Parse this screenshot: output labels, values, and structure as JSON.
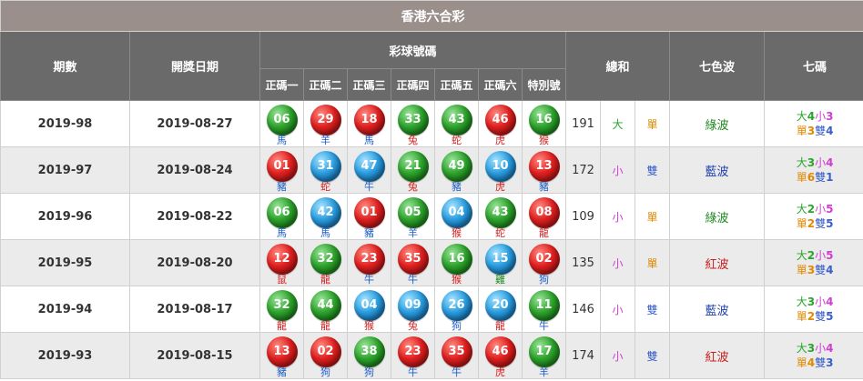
{
  "title": "香港六合彩",
  "headers": {
    "period": "期數",
    "date": "開獎日期",
    "balls": "彩球號碼",
    "sum": "總和",
    "seven_wave": "七色波",
    "seven_code": "七碼",
    "sub": [
      "正碼一",
      "正碼二",
      "正碼三",
      "正碼四",
      "正碼五",
      "正碼六",
      "特別號"
    ]
  },
  "rows": [
    {
      "period": "2019-98",
      "date": "2019-08-27",
      "balls": [
        {
          "num": "06",
          "color": "green",
          "zodiac": "馬",
          "zc": "blue"
        },
        {
          "num": "29",
          "color": "red",
          "zodiac": "羊",
          "zc": "blue"
        },
        {
          "num": "18",
          "color": "red",
          "zodiac": "馬",
          "zc": "blue"
        },
        {
          "num": "33",
          "color": "green",
          "zodiac": "兔",
          "zc": "red"
        },
        {
          "num": "43",
          "color": "green",
          "zodiac": "蛇",
          "zc": "red"
        },
        {
          "num": "46",
          "color": "red",
          "zodiac": "虎",
          "zc": "red"
        },
        {
          "num": "16",
          "color": "green",
          "zodiac": "猴",
          "zc": "red"
        }
      ],
      "sum": "191",
      "size": "大",
      "parity": "單",
      "wave": "綠波",
      "wave_color": "green",
      "seven": {
        "big": "大",
        "big_n": "4",
        "small": "小",
        "small_n": "3",
        "odd": "單",
        "odd_n": "3",
        "even": "雙",
        "even_n": "4"
      }
    },
    {
      "period": "2019-97",
      "date": "2019-08-24",
      "balls": [
        {
          "num": "01",
          "color": "red",
          "zodiac": "豬",
          "zc": "blue"
        },
        {
          "num": "31",
          "color": "blue",
          "zodiac": "蛇",
          "zc": "red"
        },
        {
          "num": "47",
          "color": "blue",
          "zodiac": "牛",
          "zc": "blue"
        },
        {
          "num": "21",
          "color": "green",
          "zodiac": "兔",
          "zc": "red"
        },
        {
          "num": "49",
          "color": "green",
          "zodiac": "豬",
          "zc": "blue"
        },
        {
          "num": "10",
          "color": "blue",
          "zodiac": "虎",
          "zc": "red"
        },
        {
          "num": "13",
          "color": "red",
          "zodiac": "豬",
          "zc": "blue"
        }
      ],
      "sum": "172",
      "size": "小",
      "parity": "雙",
      "wave": "藍波",
      "wave_color": "blue",
      "seven": {
        "big": "大",
        "big_n": "3",
        "small": "小",
        "small_n": "4",
        "odd": "單",
        "odd_n": "6",
        "even": "雙",
        "even_n": "1"
      }
    },
    {
      "period": "2019-96",
      "date": "2019-08-22",
      "balls": [
        {
          "num": "06",
          "color": "green",
          "zodiac": "馬",
          "zc": "blue"
        },
        {
          "num": "42",
          "color": "blue",
          "zodiac": "馬",
          "zc": "blue"
        },
        {
          "num": "01",
          "color": "red",
          "zodiac": "豬",
          "zc": "blue"
        },
        {
          "num": "05",
          "color": "green",
          "zodiac": "羊",
          "zc": "blue"
        },
        {
          "num": "04",
          "color": "blue",
          "zodiac": "猴",
          "zc": "red"
        },
        {
          "num": "43",
          "color": "green",
          "zodiac": "蛇",
          "zc": "red"
        },
        {
          "num": "08",
          "color": "red",
          "zodiac": "龍",
          "zc": "red"
        }
      ],
      "sum": "109",
      "size": "小",
      "parity": "單",
      "wave": "綠波",
      "wave_color": "green",
      "seven": {
        "big": "大",
        "big_n": "2",
        "small": "小",
        "small_n": "5",
        "odd": "單",
        "odd_n": "2",
        "even": "雙",
        "even_n": "5"
      }
    },
    {
      "period": "2019-95",
      "date": "2019-08-20",
      "balls": [
        {
          "num": "12",
          "color": "red",
          "zodiac": "鼠",
          "zc": "red"
        },
        {
          "num": "32",
          "color": "green",
          "zodiac": "龍",
          "zc": "red"
        },
        {
          "num": "23",
          "color": "red",
          "zodiac": "牛",
          "zc": "blue"
        },
        {
          "num": "35",
          "color": "red",
          "zodiac": "牛",
          "zc": "blue"
        },
        {
          "num": "16",
          "color": "green",
          "zodiac": "猴",
          "zc": "red"
        },
        {
          "num": "15",
          "color": "blue",
          "zodiac": "雞",
          "zc": "green"
        },
        {
          "num": "02",
          "color": "red",
          "zodiac": "狗",
          "zc": "blue"
        }
      ],
      "sum": "135",
      "size": "小",
      "parity": "單",
      "wave": "紅波",
      "wave_color": "red",
      "seven": {
        "big": "大",
        "big_n": "2",
        "small": "小",
        "small_n": "5",
        "odd": "單",
        "odd_n": "3",
        "even": "雙",
        "even_n": "4"
      }
    },
    {
      "period": "2019-94",
      "date": "2019-08-17",
      "balls": [
        {
          "num": "32",
          "color": "green",
          "zodiac": "龍",
          "zc": "red"
        },
        {
          "num": "44",
          "color": "green",
          "zodiac": "龍",
          "zc": "red"
        },
        {
          "num": "04",
          "color": "blue",
          "zodiac": "猴",
          "zc": "red"
        },
        {
          "num": "09",
          "color": "blue",
          "zodiac": "兔",
          "zc": "red"
        },
        {
          "num": "26",
          "color": "blue",
          "zodiac": "狗",
          "zc": "blue"
        },
        {
          "num": "20",
          "color": "blue",
          "zodiac": "龍",
          "zc": "red"
        },
        {
          "num": "11",
          "color": "green",
          "zodiac": "牛",
          "zc": "blue"
        }
      ],
      "sum": "146",
      "size": "小",
      "parity": "雙",
      "wave": "藍波",
      "wave_color": "blue",
      "seven": {
        "big": "大",
        "big_n": "3",
        "small": "小",
        "small_n": "4",
        "odd": "單",
        "odd_n": "2",
        "even": "雙",
        "even_n": "5"
      }
    },
    {
      "period": "2019-93",
      "date": "2019-08-15",
      "balls": [
        {
          "num": "13",
          "color": "red",
          "zodiac": "豬",
          "zc": "blue"
        },
        {
          "num": "02",
          "color": "red",
          "zodiac": "狗",
          "zc": "blue"
        },
        {
          "num": "38",
          "color": "green",
          "zodiac": "狗",
          "zc": "blue"
        },
        {
          "num": "23",
          "color": "red",
          "zodiac": "牛",
          "zc": "blue"
        },
        {
          "num": "35",
          "color": "red",
          "zodiac": "牛",
          "zc": "blue"
        },
        {
          "num": "46",
          "color": "red",
          "zodiac": "虎",
          "zc": "red"
        },
        {
          "num": "17",
          "color": "green",
          "zodiac": "羊",
          "zc": "blue"
        }
      ],
      "sum": "174",
      "size": "小",
      "parity": "雙",
      "wave": "紅波",
      "wave_color": "red",
      "seven": {
        "big": "大",
        "big_n": "3",
        "small": "小",
        "small_n": "4",
        "odd": "單",
        "odd_n": "4",
        "even": "雙",
        "even_n": "3"
      }
    }
  ]
}
